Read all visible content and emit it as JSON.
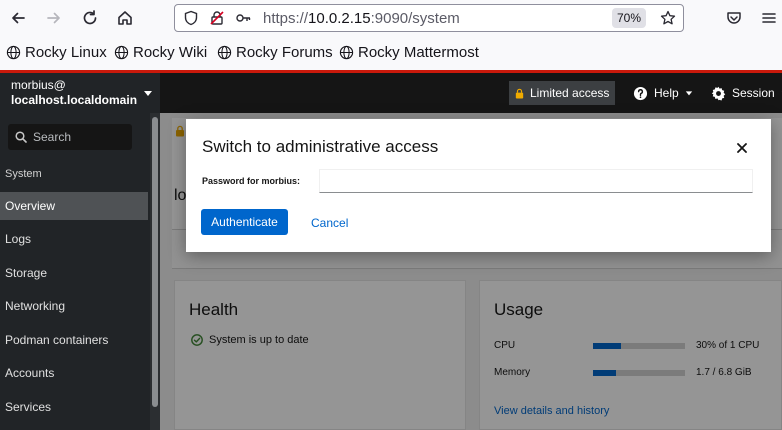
{
  "browser": {
    "url_scheme": "https://",
    "url_host": "10.0.2.15",
    "url_rest": ":9090/system",
    "zoom": "70%",
    "bookmarks": [
      {
        "label": "Rocky Linux"
      },
      {
        "label": "Rocky Wiki"
      },
      {
        "label": "Rocky Forums"
      },
      {
        "label": "Rocky Mattermost"
      }
    ]
  },
  "masthead": {
    "user": "morbius@",
    "host": "localhost.localdomain",
    "limited_access": "Limited access",
    "help": "Help",
    "session": "Session"
  },
  "sidebar": {
    "search_placeholder": "Search",
    "section": "System",
    "items": [
      {
        "label": "Overview",
        "active": true
      },
      {
        "label": "Logs"
      },
      {
        "label": "Storage"
      },
      {
        "label": "Networking"
      },
      {
        "label": "Podman containers"
      },
      {
        "label": "Accounts"
      },
      {
        "label": "Services"
      }
    ]
  },
  "page": {
    "title_partial": "lo",
    "health": {
      "title": "Health",
      "status": "System is up to date"
    },
    "usage": {
      "title": "Usage",
      "rows": [
        {
          "label": "CPU",
          "value": "30% of 1 CPU",
          "fraction": 0.3
        },
        {
          "label": "Memory",
          "value": "1.7 / 6.8 GiB",
          "fraction": 0.25
        }
      ],
      "link": "View details and history"
    }
  },
  "modal": {
    "title": "Switch to administrative access",
    "password_label": "Password for morbius:",
    "password_value": "",
    "authenticate": "Authenticate",
    "cancel": "Cancel"
  },
  "colors": {
    "accent": "#0066cc",
    "browser_accent": "#c9190b",
    "masthead": "#151515",
    "sidebar": "#212427"
  }
}
